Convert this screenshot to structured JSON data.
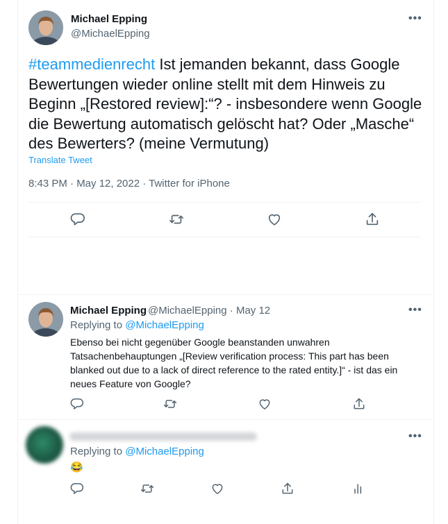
{
  "main_tweet": {
    "author_name": "Michael Epping",
    "author_handle": "@MichaelEpping",
    "hashtag": "#teammedienrecht",
    "text": " Ist jemanden bekannt, dass Google Bewertungen wieder online stellt mit dem Hinweis zu Beginn „[Restored review]:“? - insbesondere wenn Google die Bewertung automatisch gelöscht hat? Oder „Masche“ des Bewerters? (meine Vermutung)",
    "translate_label": "Translate Tweet",
    "meta": "8:43 PM · May 12, 2022 · Twitter for iPhone",
    "more_label": "•••"
  },
  "reply_1": {
    "author_name": "Michael Epping",
    "author_meta": "@MichaelEpping · May 12",
    "replying_prefix": "Replying to",
    "replying_to": "@MichaelEpping",
    "text": "Ebenso bei nicht gegenüber Google beanstanden unwahren Tatsachenbehauptungen „[Review verification process: This part has been blanked out due to a lack of direct reference to the rated entity.]“ - ist das ein neues Feature von Google?",
    "more_label": "•••"
  },
  "reply_2": {
    "replying_prefix": "Replying to",
    "replying_to": "@MichaelEpping",
    "text": "😂",
    "more_label": "•••"
  },
  "icons": [
    "reply-icon",
    "retweet-icon",
    "like-icon",
    "share-icon",
    "analytics-icon",
    "more-icon"
  ],
  "colors": {
    "accent": "#1d9bf0",
    "text": "#0f1419",
    "secondary": "#536471",
    "divider": "#eff3f4"
  }
}
